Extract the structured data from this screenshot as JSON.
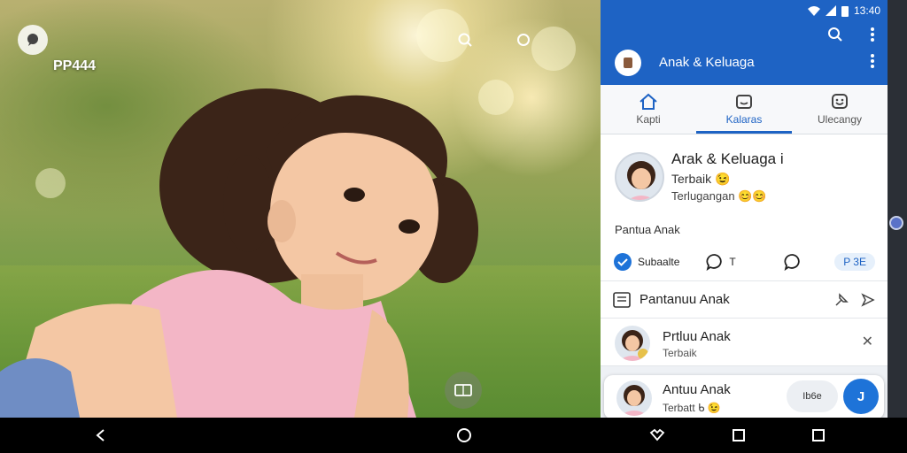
{
  "media": {
    "label": "PP444"
  },
  "statusbar": {
    "time": "13:40"
  },
  "appbar": {
    "title": "Anak & Keluaga"
  },
  "tabs": [
    {
      "label": "Kapti",
      "icon": "home-icon"
    },
    {
      "label": "Kalaras",
      "icon": "inbox-icon"
    },
    {
      "label": "Ulecangy",
      "icon": "smiley-icon"
    }
  ],
  "profile": {
    "name": "Arak & Keluaga i",
    "line1": "Terbaik 😉",
    "line2": "Terlugangan 😊😊"
  },
  "section_label": "Pantua Anak",
  "actions": {
    "subscribe_label": "Subaalte",
    "comment_count": "T",
    "pill_label": "P 3E"
  },
  "monitor_row": {
    "label": "Pantanuu Anak"
  },
  "list_item": {
    "title": "Prtluu Anak",
    "subtitle": "Terbaik"
  },
  "card": {
    "title": "Antuu Anak",
    "subtitle": "Terbatt ᑲ 😉",
    "chip": "Ib6e",
    "fab_label": "J"
  },
  "colors": {
    "primary": "#1e63c4",
    "fab": "#1e73d8",
    "photo_dress": "#f3b6c6"
  }
}
